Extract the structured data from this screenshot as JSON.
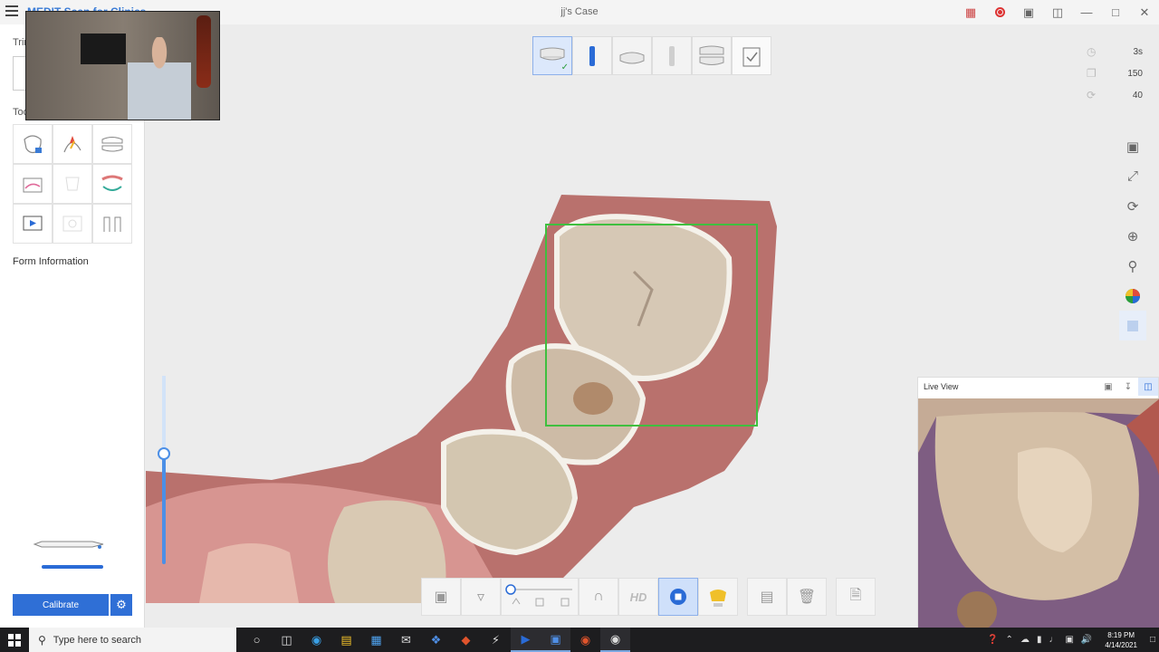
{
  "titlebar": {
    "app_title": "MEDIT Scan for Clinics",
    "case_title": "jj's Case"
  },
  "left_panel": {
    "trim_label": "Trim",
    "tools_label": "Tools",
    "form_info_label": "Form Information",
    "calibrate_label": "Calibrate"
  },
  "stats": {
    "time": "3s",
    "frames": "150",
    "rotation": "40"
  },
  "live_view": {
    "title": "Live View"
  },
  "bottom_tools": {
    "hd_label": "HD"
  },
  "taskbar": {
    "search_placeholder": "Type here to search",
    "time": "8:19 PM",
    "date": "4/14/2021"
  },
  "colors": {
    "accent": "#2f6fd6",
    "scan_box": "#3fbf3f",
    "gum": "#b86a68",
    "tooth": "#d8cbb8"
  }
}
